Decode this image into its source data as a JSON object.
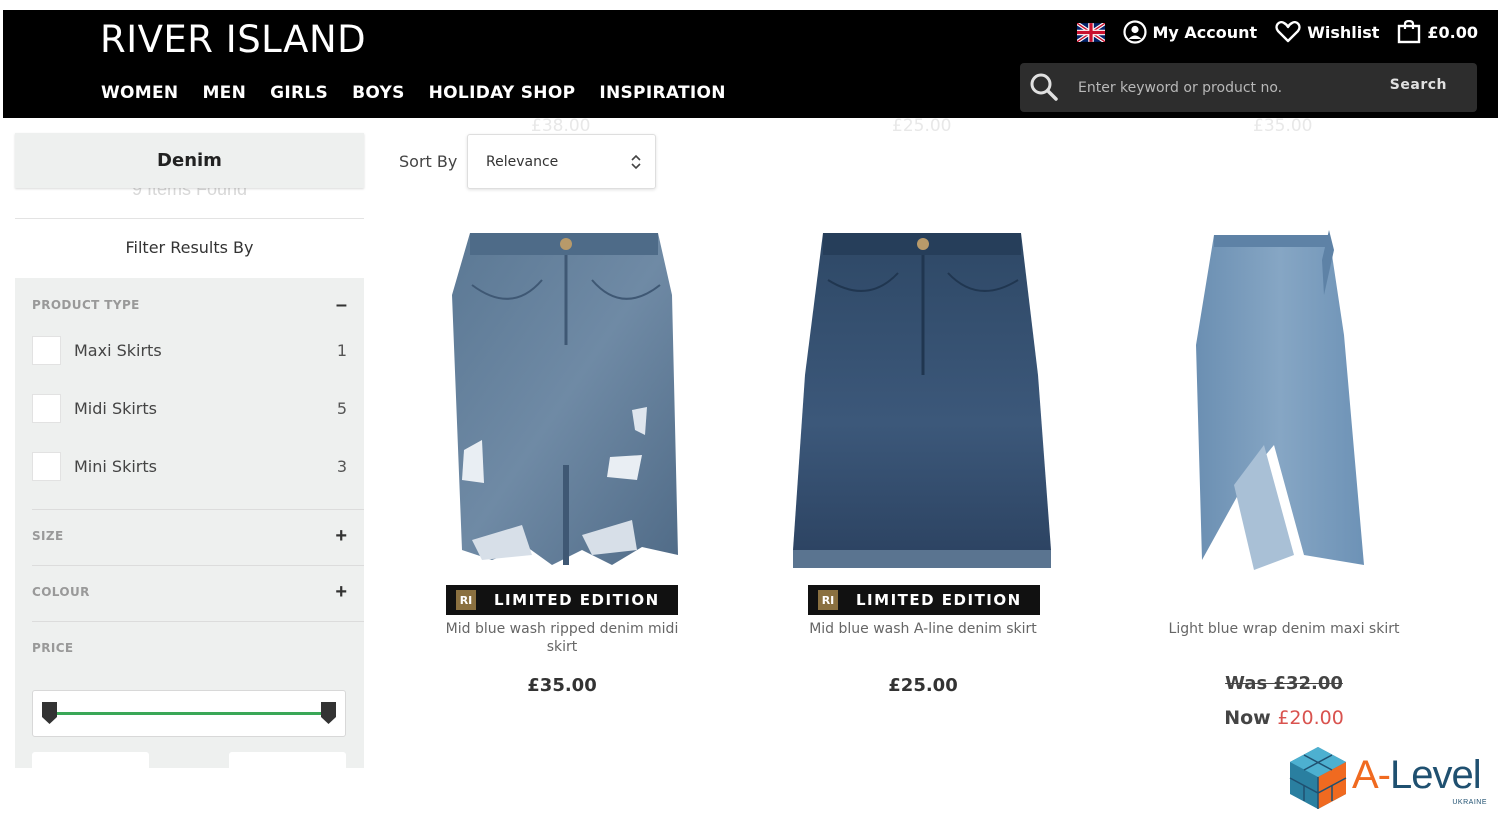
{
  "header": {
    "logo": "RIVER ISLAND",
    "nav": [
      "WOMEN",
      "MEN",
      "GIRLS",
      "BOYS",
      "HOLIDAY SHOP",
      "INSPIRATION"
    ],
    "account_label": "My Account",
    "wishlist_label": "Wishlist",
    "basket_total": "£0.00",
    "search_placeholder": "Enter keyword or product no.",
    "search_button": "Search",
    "flag_icon": "uk-flag-icon"
  },
  "ghost_prices": [
    "£38.00",
    "£25.00",
    "£35.00"
  ],
  "sidebar": {
    "category": "Denim",
    "items_found": "9 Items Found",
    "filter_title": "Filter Results By",
    "product_type": {
      "heading": "PRODUCT TYPE",
      "toggle": "–",
      "options": [
        {
          "label": "Maxi Skirts",
          "count": "1"
        },
        {
          "label": "Midi Skirts",
          "count": "5"
        },
        {
          "label": "Mini Skirts",
          "count": "3"
        }
      ]
    },
    "size": {
      "heading": "SIZE",
      "toggle": "+"
    },
    "colour": {
      "heading": "COLOUR",
      "toggle": "+"
    },
    "price": {
      "heading": "PRICE"
    }
  },
  "sort": {
    "label": "Sort By",
    "selected": "Relevance"
  },
  "products": [
    {
      "name": "Mid blue wash ripped denim midi skirt",
      "price": "£35.00",
      "badge": "LIMITED EDITION"
    },
    {
      "name": "Mid blue wash A-line denim skirt",
      "price": "£25.00",
      "badge": "LIMITED EDITION"
    },
    {
      "name": "Light blue wrap denim maxi skirt",
      "was_price": "Was £32.00",
      "now_label": "Now",
      "now_price": "£20.00"
    }
  ],
  "brand_watermark": {
    "a": "A-",
    "level": "Level",
    "sub": "UKRAINE"
  },
  "colors": {
    "header_bg": "#000000",
    "sidebar_bg": "#eef0ef",
    "slider_green": "#3aa757",
    "sale_red": "#d9534f",
    "badge_gold": "#8a7040"
  }
}
